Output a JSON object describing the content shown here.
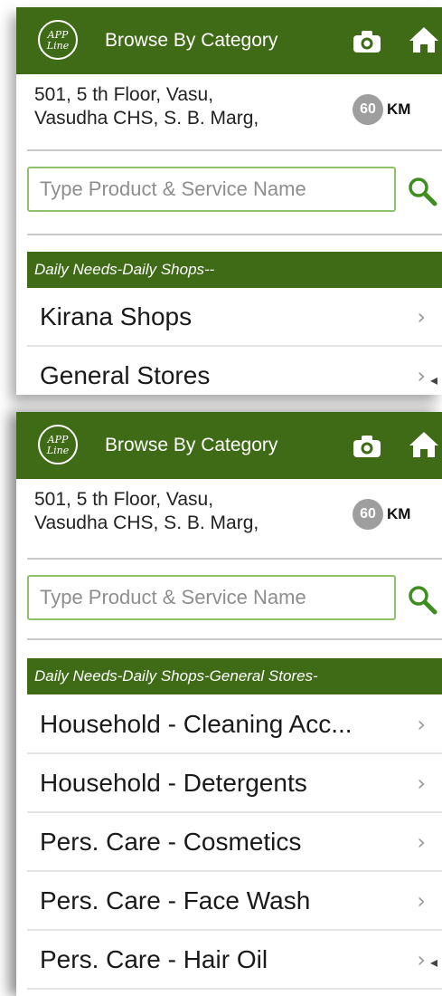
{
  "header": {
    "logo_text": "APP Line",
    "title": "Browse By Category"
  },
  "address": {
    "line1": "501, 5 th Floor, Vasu,",
    "line2": "Vasudha CHS, S. B. Marg,"
  },
  "distance": {
    "value": "60",
    "unit": "KM"
  },
  "search": {
    "placeholder": "Type Product & Service Name"
  },
  "screens": [
    {
      "breadcrumb": "Daily Needs-Daily Shops--",
      "items": [
        "Kirana Shops",
        "General Stores"
      ]
    },
    {
      "breadcrumb": "Daily Needs-Daily Shops-General Stores-",
      "items": [
        "Household - Cleaning Acc...",
        "Household - Detergents",
        "Pers. Care - Cosmetics",
        "Pers. Care - Face Wash",
        "Pers. Care - Hair Oil"
      ]
    }
  ],
  "colors": {
    "appbar": "#3f6b17",
    "search_border": "#8dc16a",
    "distance_badge": "#9e9e9e"
  }
}
